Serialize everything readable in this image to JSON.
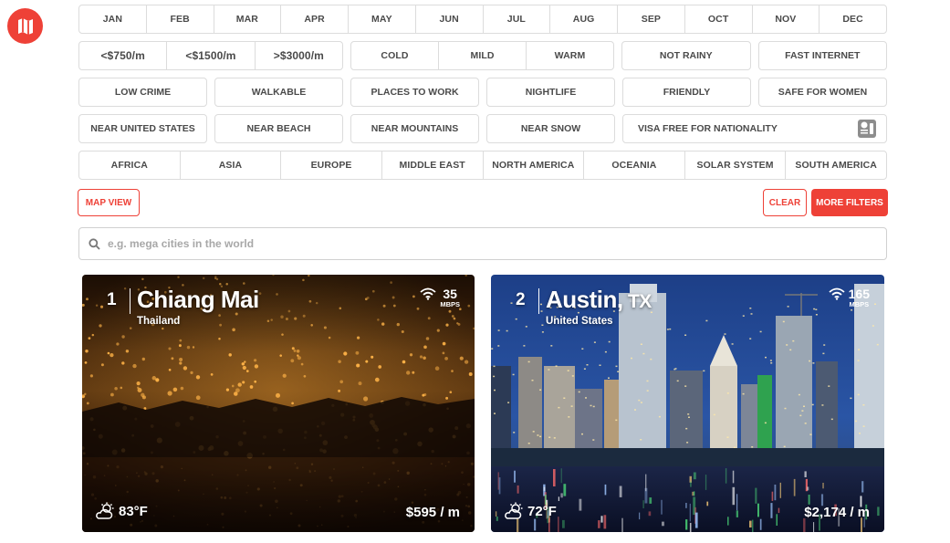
{
  "colors": {
    "accent": "#ee4137",
    "border": "#dcdcdc",
    "text": "#4a4a4a"
  },
  "months": [
    "JAN",
    "FEB",
    "MAR",
    "APR",
    "MAY",
    "JUN",
    "JUL",
    "AUG",
    "SEP",
    "OCT",
    "NOV",
    "DEC"
  ],
  "cost_filters": [
    "<$750/m",
    "<$1500/m",
    ">$3000/m"
  ],
  "climate_filters": [
    "COLD",
    "MILD",
    "WARM"
  ],
  "weather_filters": [
    "NOT RAINY",
    "FAST INTERNET"
  ],
  "row3_filters": [
    "LOW CRIME",
    "WALKABLE",
    "PLACES TO WORK",
    "NIGHTLIFE",
    "FRIENDLY",
    "SAFE FOR WOMEN"
  ],
  "row4_filters": [
    "NEAR UNITED STATES",
    "NEAR BEACH",
    "NEAR MOUNTAINS",
    "NEAR SNOW"
  ],
  "visa_filter": {
    "label": "VISA FREE FOR NATIONALITY",
    "icon": "passport-icon"
  },
  "regions": [
    "AFRICA",
    "ASIA",
    "EUROPE",
    "MIDDLE EAST",
    "NORTH AMERICA",
    "OCEANIA",
    "SOLAR SYSTEM",
    "SOUTH AMERICA"
  ],
  "buttons": {
    "map_view": "MAP VIEW",
    "clear": "CLEAR",
    "more_filters": "MORE FILTERS"
  },
  "search": {
    "placeholder": "e.g. mega cities in the world",
    "icon": "search-icon"
  },
  "cards": [
    {
      "rank": "1",
      "city": "Chiang Mai",
      "state": "",
      "country": "Thailand",
      "speed": "35",
      "speed_unit": "MBPS",
      "temp": "83°F",
      "cost": "$595 / m"
    },
    {
      "rank": "2",
      "city": "Austin,",
      "state": " TX",
      "country": "United States",
      "speed": "165",
      "speed_unit": "MBPS",
      "temp": "72°F",
      "cost": "$2,174 / m"
    }
  ]
}
